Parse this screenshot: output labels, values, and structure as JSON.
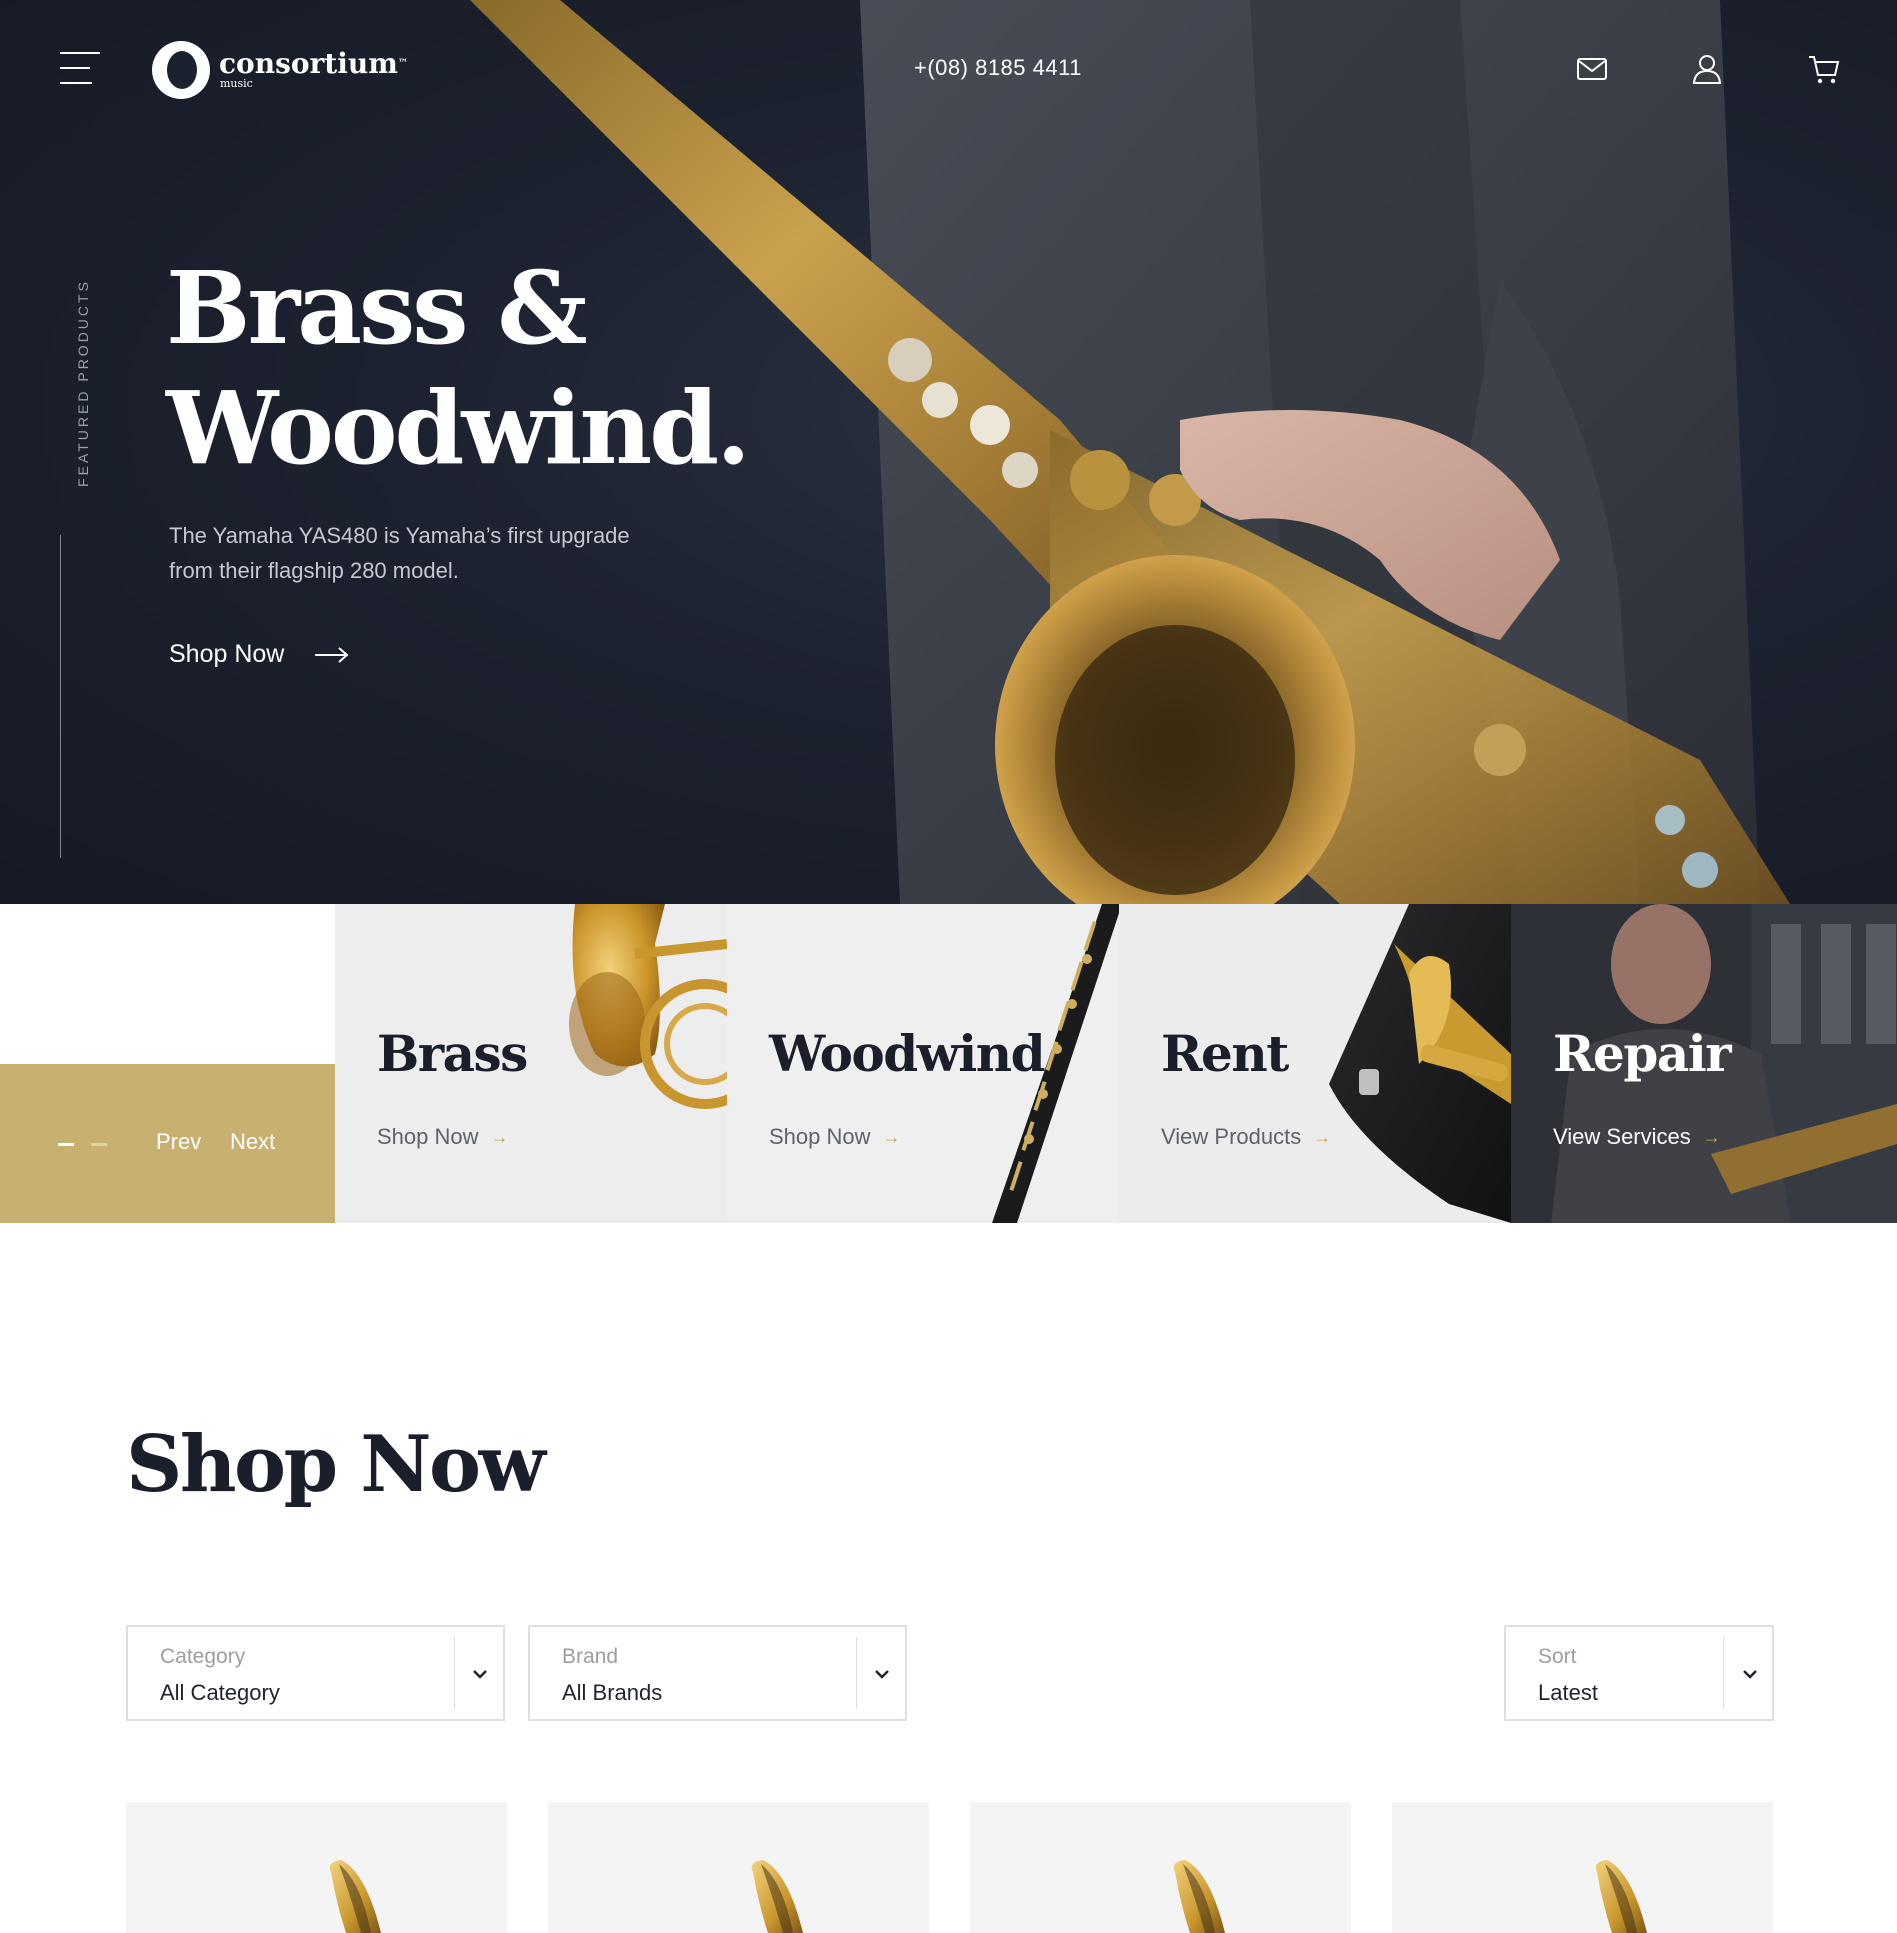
{
  "header": {
    "logo_name": "consortium",
    "logo_tm": "™",
    "logo_sub": "music",
    "phone": "+(08) 8185 4411"
  },
  "icons": {
    "menu": "hamburger-menu-icon",
    "mail": "mail-icon",
    "account": "user-icon",
    "cart": "cart-icon"
  },
  "hero": {
    "side_label": "FEATURED PRODUCTS",
    "title_line1": "Brass &",
    "title_line2": "Woodwind.",
    "description": "The Yamaha YAS480 is Yamaha’s first upgrade from their flagship 280 model.",
    "cta": "Shop Now"
  },
  "slider": {
    "prev": "Prev",
    "next": "Next"
  },
  "categories": [
    {
      "title": "Brass",
      "link": "Shop Now"
    },
    {
      "title": "Woodwind",
      "link": "Shop Now"
    },
    {
      "title": "Rent",
      "link": "View Products"
    },
    {
      "title": "Repair",
      "link": "View Services"
    }
  ],
  "shop": {
    "title": "Shop Now",
    "filters": [
      {
        "label": "Category",
        "value": "All Category"
      },
      {
        "label": "Brand",
        "value": "All Brands"
      }
    ],
    "sort": {
      "label": "Sort",
      "value": "Latest"
    }
  },
  "colors": {
    "accent_gold": "#c8b070",
    "dark_navy": "#1b1f2b",
    "arrow_gold": "#c8a45a"
  }
}
